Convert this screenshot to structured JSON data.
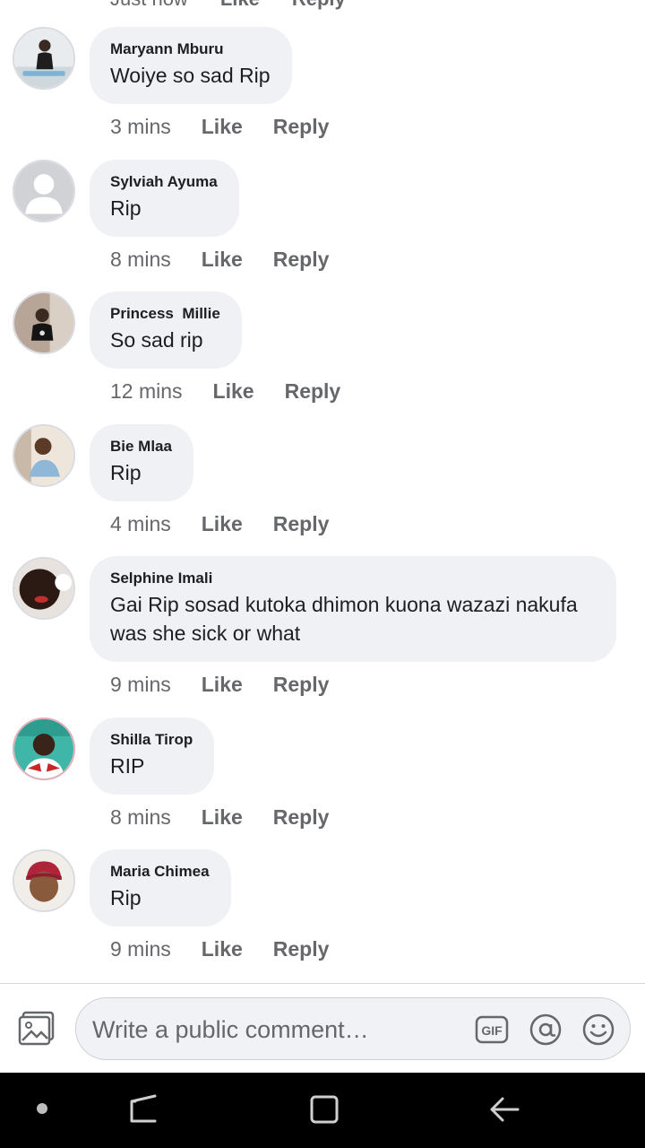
{
  "top_partial": {
    "time": "Just now",
    "like_label": "Like",
    "reply_label": "Reply"
  },
  "comments": [
    {
      "name": "Maryann Mburu",
      "text": "Woiye so sad Rip",
      "time": "3 mins"
    },
    {
      "name": "Sylviah Ayuma",
      "text": "Rip",
      "time": "8 mins"
    },
    {
      "name": "Princess  Millie",
      "text": "So sad rip",
      "time": "12 mins"
    },
    {
      "name": "Bie Mlaa",
      "text": "Rip",
      "time": "4 mins"
    },
    {
      "name": "Selphine Imali",
      "text": "Gai Rip sosad kutoka dhimon kuona wazazi nakufa was she sick or what",
      "time": "9 mins"
    },
    {
      "name": "Shilla Tirop",
      "text": "RIP",
      "time": "8 mins"
    },
    {
      "name": "Maria Chimea",
      "text": "Rip",
      "time": "9 mins"
    }
  ],
  "actions": {
    "like_label": "Like",
    "reply_label": "Reply"
  },
  "composer": {
    "placeholder": "Write a public comment…",
    "photo_icon": "photo-icon",
    "gif_icon": "gif-icon",
    "mention_icon": "at-sign-icon",
    "emoji_icon": "smiley-icon"
  },
  "navbar": {
    "icons": [
      "dot-icon",
      "recent-apps-icon",
      "home-icon",
      "back-icon"
    ]
  },
  "colors": {
    "bubble": "#f0f1f5",
    "meta_text": "#65676b",
    "navbar": "#000000"
  }
}
